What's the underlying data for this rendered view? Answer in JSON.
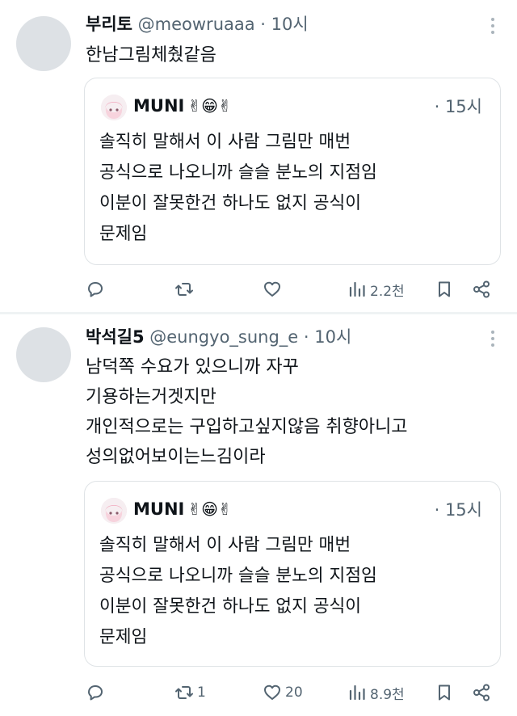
{
  "tweets": [
    {
      "name": "부리토",
      "handle": "@meowruaaa",
      "dot": "·",
      "time": "10시",
      "lines": [
        "한남그림체췄같음"
      ],
      "quote": {
        "name": "MUNI",
        "emoji": "✌😁✌",
        "time": "· 15시",
        "lines": [
          "솔직히 말해서 이 사람 그림만 매번",
          "공식으로 나오니까 슬슬 분노의 지점임",
          "이분이 잘못한건 하나도 없지 공식이",
          "문제임"
        ]
      },
      "actions": {
        "reply": "",
        "retweet": "",
        "like": "",
        "views": "2.2천"
      }
    },
    {
      "name": "박석길5",
      "handle": "@eungyo_sung_e",
      "dot": "·",
      "time": "10시",
      "lines": [
        "남덕쪽 수요가 있으니까 자꾸",
        "기용하는거겟지만",
        "개인적으로는 구입하고싶지않음 취향아니고",
        "성의없어보이는느김이라"
      ],
      "quote": {
        "name": "MUNI",
        "emoji": "✌😁✌",
        "time": "· 15시",
        "lines": [
          "솔직히 말해서 이 사람 그림만 매번",
          "공식으로 나오니까 슬슬 분노의 지점임",
          "이분이 잘못한건 하나도 없지 공식이",
          "문제임"
        ]
      },
      "actions": {
        "reply": "",
        "retweet": "1",
        "like": "20",
        "views": "8.9천"
      }
    }
  ],
  "icons": {
    "more": "more-vertical-icon",
    "reply": "reply-icon",
    "retweet": "retweet-icon",
    "like": "heart-icon",
    "views": "views-chart-icon",
    "bookmark": "bookmark-icon",
    "share": "share-icon"
  },
  "colors": {
    "text": "#0f1419",
    "secondary": "#536471",
    "avatar": "#dde1e5",
    "border": "#dfe3e6",
    "divider": "#eff3f4"
  }
}
